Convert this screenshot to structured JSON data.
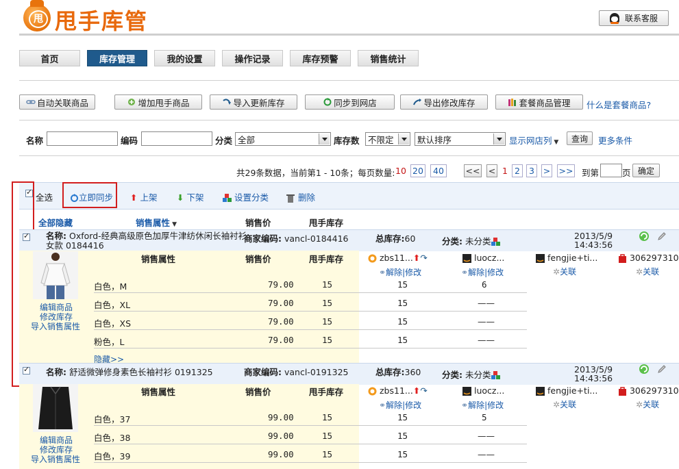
{
  "header": {
    "logo_char": "甩",
    "logo_text": "甩手库管",
    "contact_button": "联系客服"
  },
  "nav": {
    "tabs": [
      {
        "label": "首页",
        "active": false
      },
      {
        "label": "库存管理",
        "active": true
      },
      {
        "label": "我的设置",
        "active": false
      },
      {
        "label": "操作记录",
        "active": false
      },
      {
        "label": "库存预警",
        "active": false
      },
      {
        "label": "销售统计",
        "active": false
      }
    ]
  },
  "toolbar": {
    "auto_link": "自动关联商品",
    "add_product": "增加甩手商品",
    "import_update": "导入更新库存",
    "sync_store": "同步到网店",
    "export_modify": "导出修改库存",
    "bundle_manage": "套餐商品管理",
    "what_is_bundle": "什么是套餐商品?"
  },
  "filter": {
    "name_label": "名称",
    "code_label": "编码",
    "category_label": "分类",
    "category_value": "全部",
    "stock_label": "库存数",
    "stock_value": "不限定",
    "sort_value": "默认排序",
    "show_store": "显示网店列",
    "query_button": "查询",
    "more_conditions": "更多条件"
  },
  "pagination": {
    "summary": "共29条数据，当前第1 - 10条；每页数量:",
    "per_page": [
      "10",
      "20",
      "40"
    ],
    "first": "<<",
    "prev": "<",
    "pages": [
      "1",
      "2",
      "3"
    ],
    "next": ">",
    "last": ">>",
    "goto_label": "到第",
    "page_unit": "页",
    "confirm": "确定"
  },
  "actions": {
    "select_all": "全选",
    "sync_now": "立即同步",
    "shelve": "上架",
    "unshelve": "下架",
    "set_category": "设置分类",
    "delete": "删除"
  },
  "columns": {
    "hide_all": "全部隐藏",
    "sale_attr": "销售属性",
    "price": "销售价",
    "stock": "甩手库存"
  },
  "products": [
    {
      "name_label": "名称:",
      "name_line1": "Oxford-经典高级原色加厚牛津纺休闲长袖衬衫",
      "name_line2": "女款 0184416",
      "code_label": "商家编码:",
      "code": "vancl-0184416",
      "total_label": "总库存:",
      "total": "60",
      "cat_label": "分类:",
      "cat": "未分类",
      "date": "2013/5/9",
      "time": "14:43:56",
      "sub_attr": "销售属性",
      "sub_price": "销售价",
      "sub_stock": "甩手库存",
      "stores": {
        "s1": "zbs11...",
        "s1_actions": "解除|修改",
        "s2": "luocz...",
        "s2_actions": "解除|修改",
        "s3": "fengjie+ti...",
        "s3_actions": "关联",
        "s4": "306297310",
        "s4_actions": "关联"
      },
      "rows": [
        {
          "attr": "白色，M",
          "price": "79.00",
          "stock": "15",
          "s1": "15",
          "s2": "6"
        },
        {
          "attr": "白色，XL",
          "price": "79.00",
          "stock": "15",
          "s1": "15",
          "s2": "——"
        },
        {
          "attr": "白色，XS",
          "price": "79.00",
          "stock": "15",
          "s1": "15",
          "s2": "——"
        },
        {
          "attr": "粉色，L",
          "price": "79.00",
          "stock": "15",
          "s1": "15",
          "s2": "——"
        }
      ],
      "hide": "隐藏>>",
      "edit_product": "编辑商品",
      "modify_stock": "修改库存",
      "import_attr": "导入销售属性"
    },
    {
      "name_label": "名称:",
      "name_line1": "舒适微弹修身素色长袖衬衫 0191325",
      "code_label": "商家编码:",
      "code": "vancl-0191325",
      "total_label": "总库存:",
      "total": "360",
      "cat_label": "分类:",
      "cat": "未分类",
      "date": "2013/5/9",
      "time": "14:43:56",
      "sub_attr": "销售属性",
      "sub_price": "销售价",
      "sub_stock": "甩手库存",
      "stores": {
        "s1": "zbs11...",
        "s1_actions": "解除|修改",
        "s2": "luocz...",
        "s2_actions": "解除|修改",
        "s3": "fengjie+ti...",
        "s3_actions": "关联",
        "s4": "306297310",
        "s4_actions": "关联"
      },
      "rows": [
        {
          "attr": "白色，37",
          "price": "99.00",
          "stock": "15",
          "s1": "15",
          "s2": "5"
        },
        {
          "attr": "白色，38",
          "price": "99.00",
          "stock": "15",
          "s1": "15",
          "s2": "——"
        },
        {
          "attr": "白色，39",
          "price": "99.00",
          "stock": "15",
          "s1": "15",
          "s2": "——"
        }
      ],
      "edit_product": "编辑商品",
      "modify_stock": "修改库存",
      "import_attr": "导入销售属性"
    }
  ],
  "colors": {
    "brand_orange": "#e8690c",
    "nav_active": "#1f5a8c",
    "link_blue": "#1a5aa8",
    "highlight_red": "#d21d1d",
    "row_yellow": "#fffbe0"
  }
}
